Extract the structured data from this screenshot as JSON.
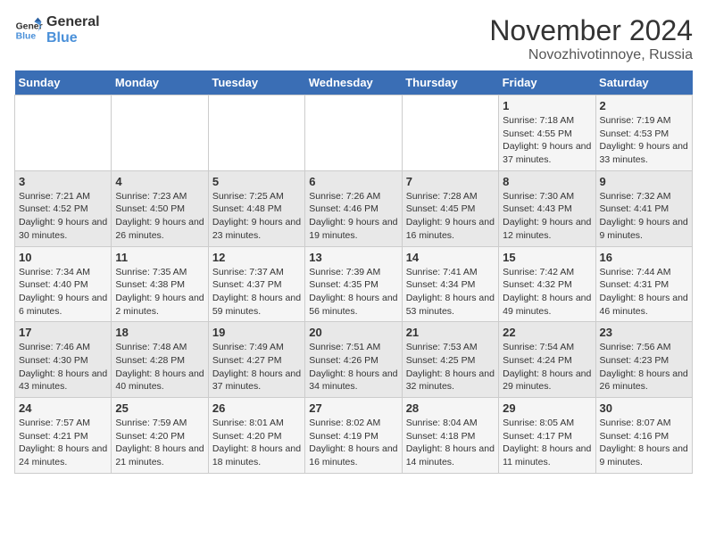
{
  "logo": {
    "line1": "General",
    "line2": "Blue"
  },
  "title": "November 2024",
  "location": "Novozhivotinnoye, Russia",
  "days_header": [
    "Sunday",
    "Monday",
    "Tuesday",
    "Wednesday",
    "Thursday",
    "Friday",
    "Saturday"
  ],
  "weeks": [
    [
      {
        "day": "",
        "info": ""
      },
      {
        "day": "",
        "info": ""
      },
      {
        "day": "",
        "info": ""
      },
      {
        "day": "",
        "info": ""
      },
      {
        "day": "",
        "info": ""
      },
      {
        "day": "1",
        "info": "Sunrise: 7:18 AM\nSunset: 4:55 PM\nDaylight: 9 hours and 37 minutes."
      },
      {
        "day": "2",
        "info": "Sunrise: 7:19 AM\nSunset: 4:53 PM\nDaylight: 9 hours and 33 minutes."
      }
    ],
    [
      {
        "day": "3",
        "info": "Sunrise: 7:21 AM\nSunset: 4:52 PM\nDaylight: 9 hours and 30 minutes."
      },
      {
        "day": "4",
        "info": "Sunrise: 7:23 AM\nSunset: 4:50 PM\nDaylight: 9 hours and 26 minutes."
      },
      {
        "day": "5",
        "info": "Sunrise: 7:25 AM\nSunset: 4:48 PM\nDaylight: 9 hours and 23 minutes."
      },
      {
        "day": "6",
        "info": "Sunrise: 7:26 AM\nSunset: 4:46 PM\nDaylight: 9 hours and 19 minutes."
      },
      {
        "day": "7",
        "info": "Sunrise: 7:28 AM\nSunset: 4:45 PM\nDaylight: 9 hours and 16 minutes."
      },
      {
        "day": "8",
        "info": "Sunrise: 7:30 AM\nSunset: 4:43 PM\nDaylight: 9 hours and 12 minutes."
      },
      {
        "day": "9",
        "info": "Sunrise: 7:32 AM\nSunset: 4:41 PM\nDaylight: 9 hours and 9 minutes."
      }
    ],
    [
      {
        "day": "10",
        "info": "Sunrise: 7:34 AM\nSunset: 4:40 PM\nDaylight: 9 hours and 6 minutes."
      },
      {
        "day": "11",
        "info": "Sunrise: 7:35 AM\nSunset: 4:38 PM\nDaylight: 9 hours and 2 minutes."
      },
      {
        "day": "12",
        "info": "Sunrise: 7:37 AM\nSunset: 4:37 PM\nDaylight: 8 hours and 59 minutes."
      },
      {
        "day": "13",
        "info": "Sunrise: 7:39 AM\nSunset: 4:35 PM\nDaylight: 8 hours and 56 minutes."
      },
      {
        "day": "14",
        "info": "Sunrise: 7:41 AM\nSunset: 4:34 PM\nDaylight: 8 hours and 53 minutes."
      },
      {
        "day": "15",
        "info": "Sunrise: 7:42 AM\nSunset: 4:32 PM\nDaylight: 8 hours and 49 minutes."
      },
      {
        "day": "16",
        "info": "Sunrise: 7:44 AM\nSunset: 4:31 PM\nDaylight: 8 hours and 46 minutes."
      }
    ],
    [
      {
        "day": "17",
        "info": "Sunrise: 7:46 AM\nSunset: 4:30 PM\nDaylight: 8 hours and 43 minutes."
      },
      {
        "day": "18",
        "info": "Sunrise: 7:48 AM\nSunset: 4:28 PM\nDaylight: 8 hours and 40 minutes."
      },
      {
        "day": "19",
        "info": "Sunrise: 7:49 AM\nSunset: 4:27 PM\nDaylight: 8 hours and 37 minutes."
      },
      {
        "day": "20",
        "info": "Sunrise: 7:51 AM\nSunset: 4:26 PM\nDaylight: 8 hours and 34 minutes."
      },
      {
        "day": "21",
        "info": "Sunrise: 7:53 AM\nSunset: 4:25 PM\nDaylight: 8 hours and 32 minutes."
      },
      {
        "day": "22",
        "info": "Sunrise: 7:54 AM\nSunset: 4:24 PM\nDaylight: 8 hours and 29 minutes."
      },
      {
        "day": "23",
        "info": "Sunrise: 7:56 AM\nSunset: 4:23 PM\nDaylight: 8 hours and 26 minutes."
      }
    ],
    [
      {
        "day": "24",
        "info": "Sunrise: 7:57 AM\nSunset: 4:21 PM\nDaylight: 8 hours and 24 minutes."
      },
      {
        "day": "25",
        "info": "Sunrise: 7:59 AM\nSunset: 4:20 PM\nDaylight: 8 hours and 21 minutes."
      },
      {
        "day": "26",
        "info": "Sunrise: 8:01 AM\nSunset: 4:20 PM\nDaylight: 8 hours and 18 minutes."
      },
      {
        "day": "27",
        "info": "Sunrise: 8:02 AM\nSunset: 4:19 PM\nDaylight: 8 hours and 16 minutes."
      },
      {
        "day": "28",
        "info": "Sunrise: 8:04 AM\nSunset: 4:18 PM\nDaylight: 8 hours and 14 minutes."
      },
      {
        "day": "29",
        "info": "Sunrise: 8:05 AM\nSunset: 4:17 PM\nDaylight: 8 hours and 11 minutes."
      },
      {
        "day": "30",
        "info": "Sunrise: 8:07 AM\nSunset: 4:16 PM\nDaylight: 8 hours and 9 minutes."
      }
    ]
  ]
}
